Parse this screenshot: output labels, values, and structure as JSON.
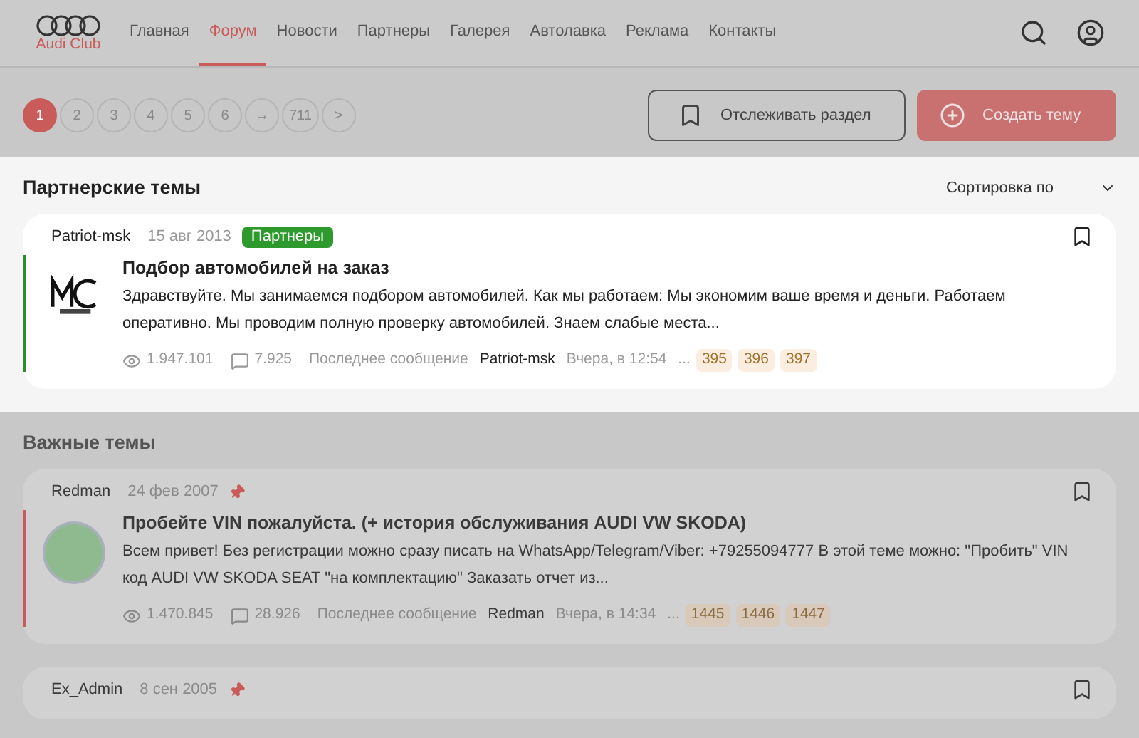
{
  "logo": {
    "text": "Audi Club"
  },
  "nav": [
    {
      "label": "Главная",
      "selected": false
    },
    {
      "label": "Форум",
      "selected": true
    },
    {
      "label": "Новости",
      "selected": false
    },
    {
      "label": "Партнеры",
      "selected": false
    },
    {
      "label": "Галерея",
      "selected": false
    },
    {
      "label": "Автолавка",
      "selected": false
    },
    {
      "label": "Реклама",
      "selected": false
    },
    {
      "label": "Контакты",
      "selected": false
    }
  ],
  "pagination": [
    {
      "label": "1",
      "selected": true
    },
    {
      "label": "2",
      "selected": false
    },
    {
      "label": "3",
      "selected": false
    },
    {
      "label": "4",
      "selected": false
    },
    {
      "label": "5",
      "selected": false
    },
    {
      "label": "6",
      "selected": false
    },
    {
      "label": "→",
      "selected": false
    },
    {
      "label": "711",
      "selected": false
    },
    {
      "label": ">",
      "selected": false
    }
  ],
  "follow_button": "Отслеживать раздел",
  "create_button": "Создать тему",
  "sections": [
    {
      "title": "Партнерские темы",
      "highlighted": true,
      "sort_label": "Сортировка по",
      "topics": [
        {
          "kind": "logo",
          "author": "Patriot-msk",
          "date": "15 авг 2013",
          "tag": "Партнеры",
          "pinned": false,
          "color": "#2e8b2e",
          "title": "Подбор автомобилей на заказ",
          "excerpt": "Здравствуйте. Мы занимаемся подбором автомобилей. Как мы работаем: Мы экономим ваше время и деньги. Работаем оперативно. Мы проводим полную проверку автомобилей. Знаем слабые места...",
          "views": "1.947.101",
          "replies": "7.925",
          "last_label": "Последнее сообщение",
          "last_author": "Patriot-msk",
          "last_time": "Вчера, в 12:54",
          "ellipsis": "...",
          "pages": [
            "395",
            "396",
            "397"
          ]
        }
      ]
    },
    {
      "title": "Важные темы",
      "highlighted": false,
      "topics": [
        {
          "kind": "round",
          "author": "Redman",
          "date": "24 фев 2007",
          "pinned": true,
          "color": "#c95b5b",
          "title": "Пробейте VIN пожалуйста. (+ история обслуживания AUDI VW SKODA)",
          "excerpt": "Всем привет! Без регистрации можно сразу писать на WhatsApp/Telegram/Viber: +79255094777 В этой теме можно: \"Пробить\" VIN код AUDI VW SKODA SEAT \"на комплектацию\" Заказать отчет из...",
          "views": "1.470.845",
          "replies": "28.926",
          "last_label": "Последнее сообщение",
          "last_author": "Redman",
          "last_time": "Вчера, в 14:34",
          "ellipsis": "...",
          "pages": [
            "1445",
            "1446",
            "1447"
          ]
        },
        {
          "author": "Ex_Admin",
          "date": "8 сен 2005",
          "pinned": true
        }
      ]
    }
  ]
}
